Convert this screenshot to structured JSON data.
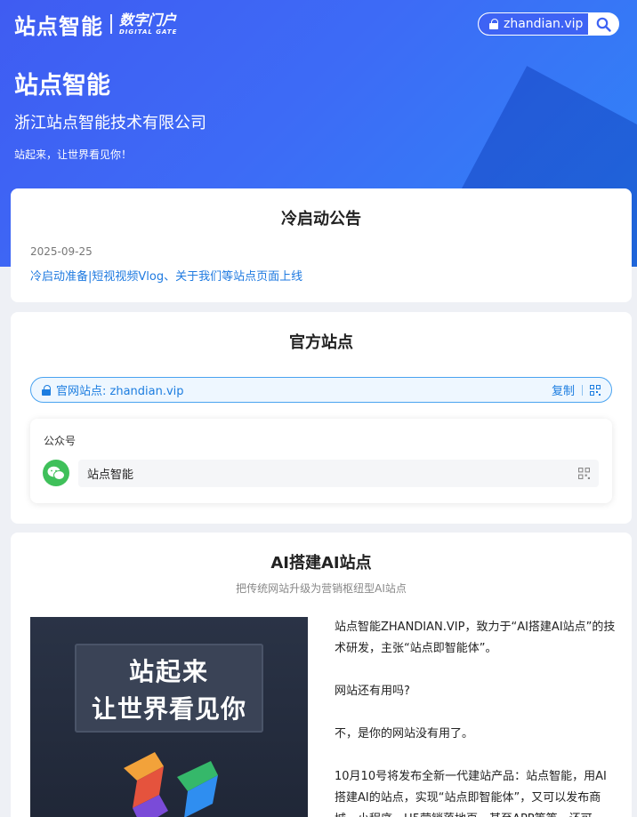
{
  "header": {
    "logo_main": "站点智能",
    "logo_sub_cn": "数字门户",
    "logo_sub_en": "DIGITAL GATE",
    "domain": "zhandian.vip"
  },
  "hero": {
    "title": "站点智能",
    "company": "浙江站点智能技术有限公司",
    "slogan": "站起来，让世界看见你！"
  },
  "notice": {
    "title": "冷启动公告",
    "date": "2025-09-25",
    "link": "冷启动准备|短视视频Vlog、关于我们等站点页面上线"
  },
  "official": {
    "title": "官方站点",
    "site_label": "官网站点: zhandian.vip",
    "copy_label": "复制",
    "gzh_label": "公众号",
    "gzh_name": "站点智能"
  },
  "ai": {
    "title": "AI搭建AI站点",
    "subtitle": "把传统网站升级为营销枢纽型AI站点",
    "image_line1": "站起来",
    "image_line2": "让世界看见你",
    "paragraphs": [
      "站点智能ZHANDIAN.VIP，致力于“AI搭建AI站点”的技术研发，主张“站点即智能体”。",
      "网站还有用吗?",
      "不，是你的网站没有用了。",
      "10月10号将发布全新一代建站产品：站点智能，用AI搭建AI的站点，实现“站点即智能体”，又可以发布商城、小程序、H5营销落地页，甚至APP等等，还可"
    ]
  },
  "colors": {
    "brand_blue": "#3e63f4",
    "link_blue": "#1f7ae0",
    "wechat_green": "#3fc05a"
  }
}
